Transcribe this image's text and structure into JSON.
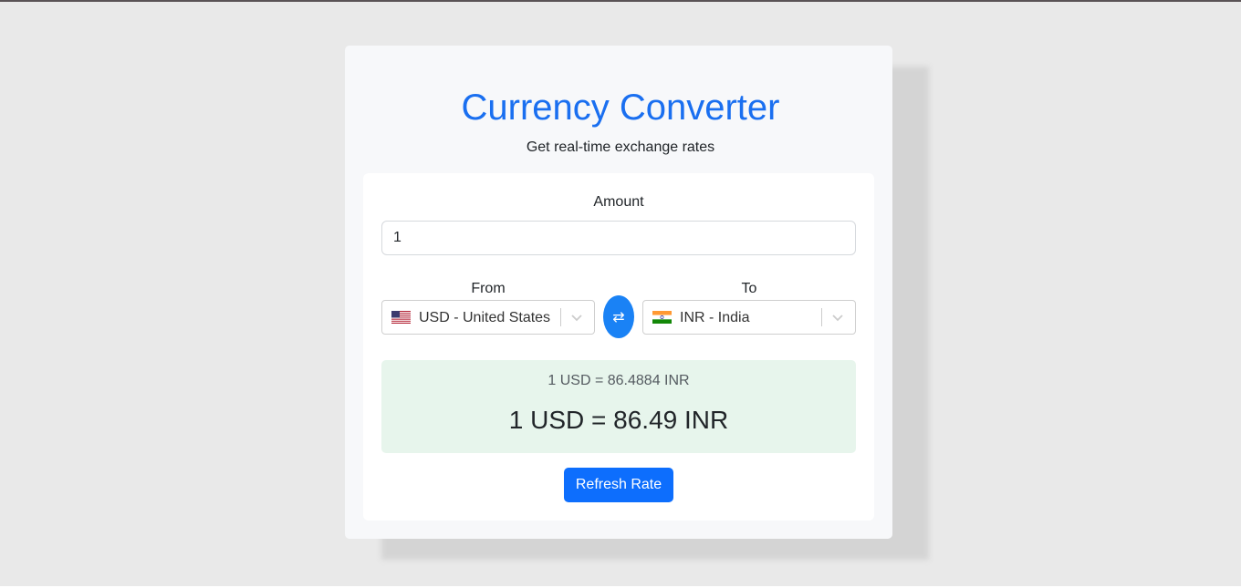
{
  "header": {
    "title": "Currency Converter",
    "subtitle": "Get real-time exchange rates"
  },
  "amount": {
    "label": "Amount",
    "value": "1"
  },
  "from": {
    "label": "From",
    "selected": "USD - United States",
    "flag_icon": "us-flag-icon"
  },
  "to": {
    "label": "To",
    "selected": "INR - India",
    "flag_icon": "india-flag-icon"
  },
  "swap": {
    "icon": "swap-arrows-icon",
    "glyph": "⇄"
  },
  "result": {
    "rate_text": "1 USD = 86.4884 INR",
    "converted_text": "1 USD = 86.49 INR"
  },
  "actions": {
    "refresh_label": "Refresh Rate"
  },
  "colors": {
    "accent": "#0d6efd",
    "title": "#1a6ff0",
    "result_bg": "#e7f5ec"
  }
}
